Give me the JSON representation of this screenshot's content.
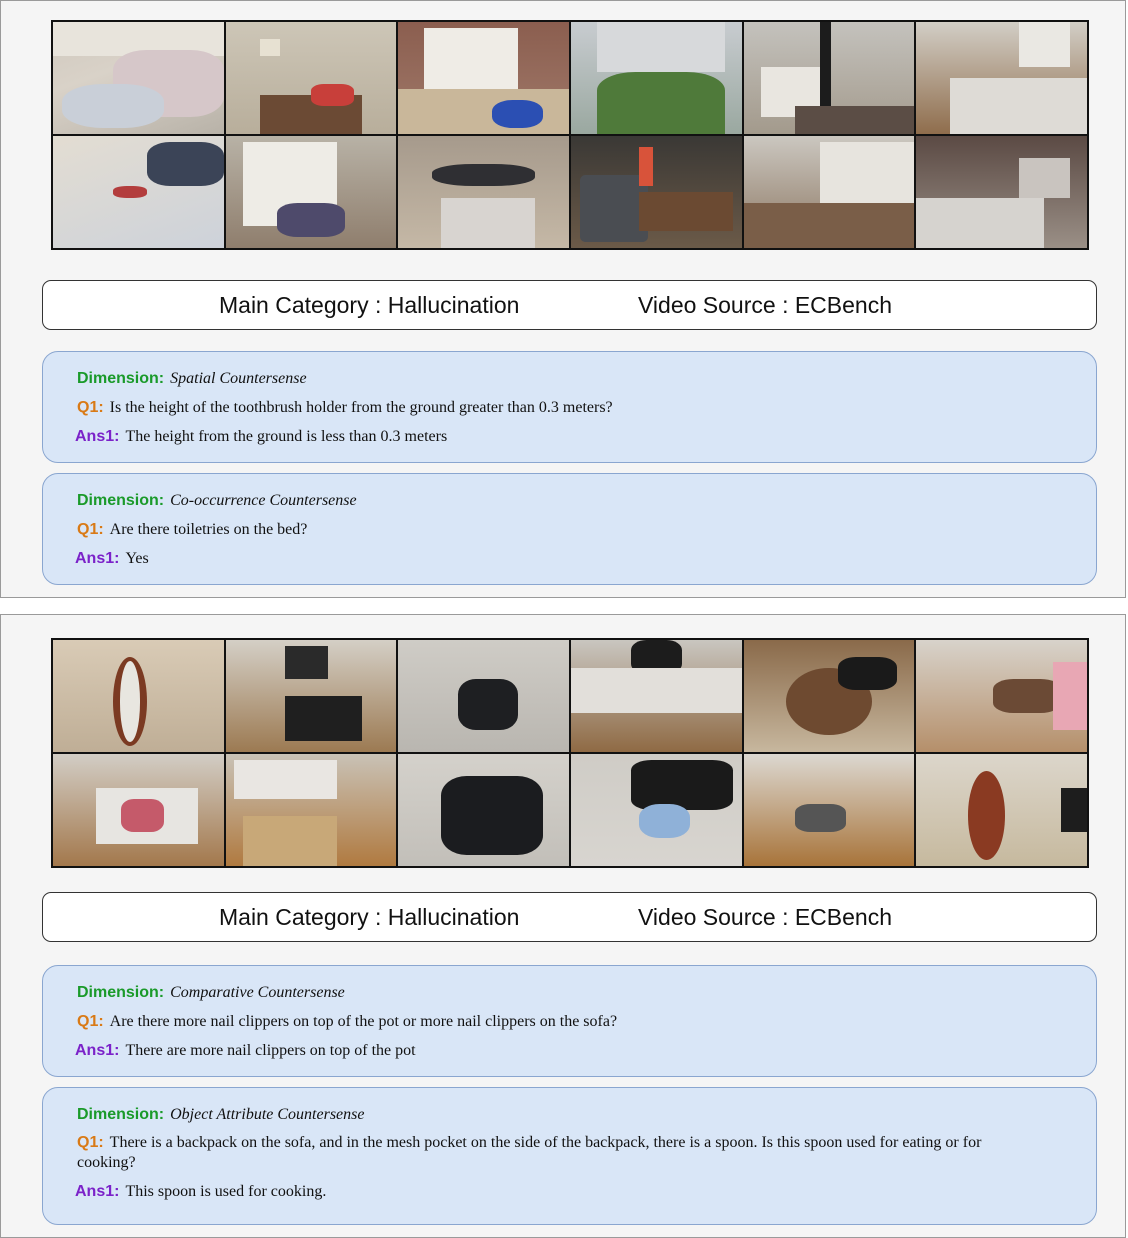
{
  "panels": [
    {
      "category_label": "Main Category : Hallucination",
      "source_label": "Video Source : ECBench",
      "qa": [
        {
          "dimension_label": "Dimension:",
          "dimension": "Spatial Countersense",
          "q_label": "Q1:",
          "question": "Is the height of the toothbrush holder from the ground greater than 0.3 meters?",
          "a_label": "Ans1:",
          "answer": "The height from the ground is less than 0.3 meters"
        },
        {
          "dimension_label": "Dimension:",
          "dimension": "Co-occurrence Countersense",
          "q_label": "Q1:",
          "question": "Are there toiletries on the bed?",
          "a_label": "Ans1:",
          "answer": "Yes"
        }
      ]
    },
    {
      "category_label": "Main Category : Hallucination",
      "source_label": "Video Source : ECBench",
      "qa": [
        {
          "dimension_label": "Dimension:",
          "dimension": "Comparative Countersense",
          "q_label": "Q1:",
          "question": "Are there more nail clippers on top of the pot or more nail clippers on the sofa?",
          "a_label": "Ans1:",
          "answer": "There are more nail clippers on top of the pot"
        },
        {
          "dimension_label": "Dimension:",
          "dimension": "Object Attribute Countersense",
          "q_label": "Q1:",
          "question": "There is a backpack on the sofa, and in the mesh pocket on the side of the backpack, there is a spoon. Is this spoon used for eating or for cooking?",
          "a_label": "Ans1:",
          "answer": "This spoon is used for cooking."
        }
      ]
    }
  ],
  "colors": {
    "dimension_label": "#1a9a2a",
    "question_label": "#d97a16",
    "answer_label": "#7b22c9",
    "qa_box": "#d9e6f7"
  }
}
